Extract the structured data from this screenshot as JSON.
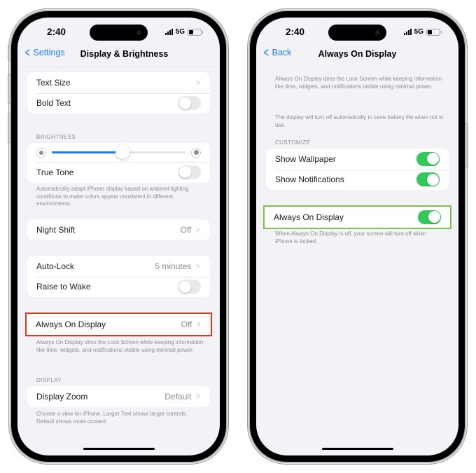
{
  "colors": {
    "accent_blue": "#1a7cf5",
    "toggle_on_green": "#34c759",
    "highlight_red": "#e8301c",
    "highlight_green": "#7cc04a",
    "background": "#f2f2f7"
  },
  "left_phone": {
    "status": {
      "time": "2:40",
      "network": "5G"
    },
    "nav": {
      "back_label": "Settings",
      "title": "Display & Brightness"
    },
    "rows": {
      "text_size": {
        "label": "Text Size"
      },
      "bold_text": {
        "label": "Bold Text",
        "on": false
      },
      "brightness_header": "BRIGHTNESS",
      "brightness_level": 0.53,
      "true_tone": {
        "label": "True Tone",
        "on": false
      },
      "true_tone_footer": "Automatically adapt iPhone display based on ambient lighting conditions to make colors appear consistent in different environments.",
      "night_shift": {
        "label": "Night Shift",
        "value": "Off"
      },
      "auto_lock": {
        "label": "Auto-Lock",
        "value": "5 minutes"
      },
      "raise_to_wake": {
        "label": "Raise to Wake",
        "on": false
      },
      "always_on": {
        "label": "Always On Display",
        "value": "Off"
      },
      "always_on_footer": "Always On Display dims the Lock Screen while keeping information like time, widgets, and notifications visible using minimal power.",
      "display_header": "DISPLAY",
      "display_zoom": {
        "label": "Display Zoom",
        "value": "Default"
      },
      "display_zoom_footer": "Choose a view for iPhone. Larger Text shows larger controls. Default shows more content."
    }
  },
  "right_phone": {
    "status": {
      "time": "2:40",
      "network": "5G"
    },
    "nav": {
      "back_label": "Back",
      "title": "Always On Display"
    },
    "intro_1": "Always On Display dims the Lock Screen while keeping information like time, widgets, and notifications visible using minimal power.",
    "intro_2": "The display will turn off automatically to save battery life when not in use.",
    "customize_header": "CUSTOMIZE",
    "show_wallpaper": {
      "label": "Show Wallpaper",
      "on": true
    },
    "show_notifications": {
      "label": "Show Notifications",
      "on": true
    },
    "always_on": {
      "label": "Always On Display",
      "on": true
    },
    "always_on_footer": "When Always On Display is off, your screen will turn off when iPhone is locked."
  }
}
